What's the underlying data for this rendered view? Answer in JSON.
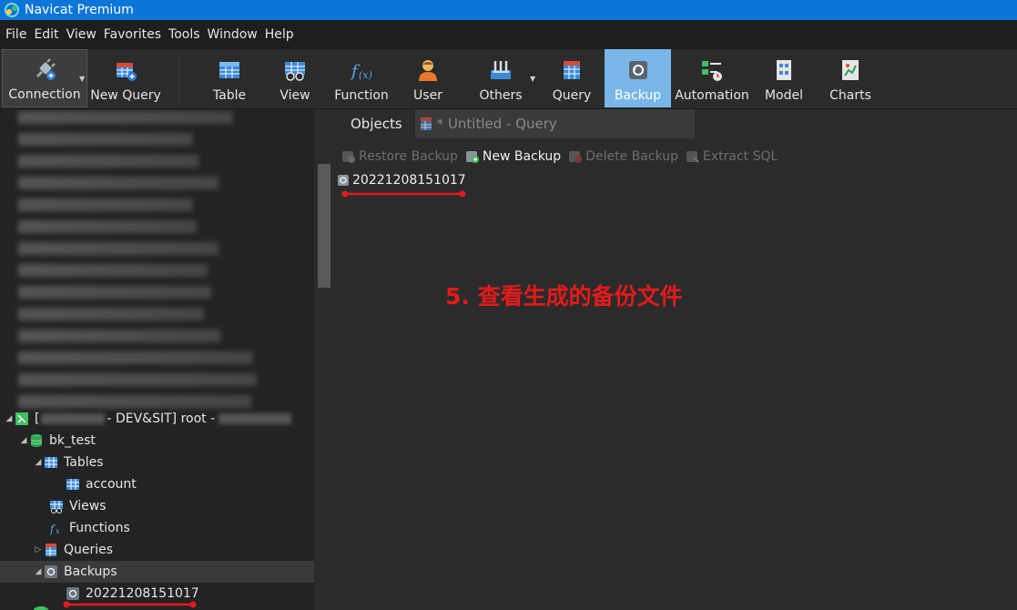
{
  "window": {
    "title": "Navicat Premium"
  },
  "menu": [
    "File",
    "Edit",
    "View",
    "Favorites",
    "Tools",
    "Window",
    "Help"
  ],
  "toolbar": {
    "connection": "Connection",
    "new_query": "New Query",
    "table": "Table",
    "view": "View",
    "function": "Function",
    "user": "User",
    "others": "Others",
    "query": "Query",
    "backup": "Backup",
    "automation": "Automation",
    "model": "Model",
    "charts": "Charts"
  },
  "tabs": {
    "objects": "Objects",
    "query": "* Untitled - Query"
  },
  "object_toolbar": {
    "restore": "Restore Backup",
    "new": "New Backup",
    "delete": "Delete Backup",
    "extract": "Extract SQL"
  },
  "backup_file": "20221208151017",
  "annotation": "5. 查看生成的备份文件",
  "tree": {
    "connection_open": "[",
    "connection_mid": " - DEV&SIT] root - ",
    "database": "bk_test",
    "tables": "Tables",
    "table_account": "account",
    "views": "Views",
    "functions": "Functions",
    "queries": "Queries",
    "backups": "Backups",
    "backup_item": "20221208151017"
  },
  "colors": {
    "accent": "#0c75d8",
    "active_button": "#7ab7e8",
    "annotation": "#e31b1b"
  }
}
